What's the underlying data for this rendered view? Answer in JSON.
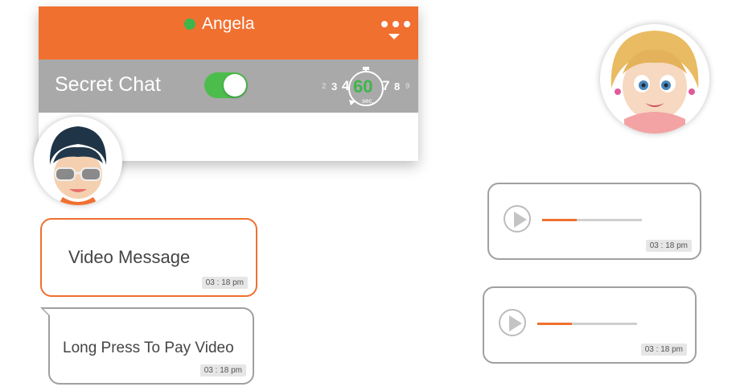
{
  "header": {
    "contact_name": "Angela",
    "status": "online",
    "menu_icon": "more-menu-icon",
    "accent_color": "#f07030",
    "online_color": "#3fb54a"
  },
  "secret_chat": {
    "label": "Secret Chat",
    "toggle_on": true,
    "timer": {
      "numbers_left": [
        "2",
        "3",
        "4"
      ],
      "selected": "60",
      "unit": "sec.",
      "numbers_right": [
        "7",
        "8",
        "9"
      ]
    }
  },
  "messages": [
    {
      "side": "left",
      "text": "Video Message",
      "time": "03 : 18 pm",
      "style": "orange-outline"
    },
    {
      "side": "left",
      "text": "Long Press To Pay Video",
      "time": "03 : 18 pm",
      "style": "grey-outline"
    },
    {
      "side": "right",
      "type": "voice",
      "time": "03 : 18 pm",
      "progress": 0.35
    },
    {
      "side": "right",
      "type": "voice",
      "time": "03 : 18 pm",
      "progress": 0.35
    }
  ],
  "avatars": {
    "left": "boy-sunglasses-avatar",
    "right": "girl-avatar"
  }
}
